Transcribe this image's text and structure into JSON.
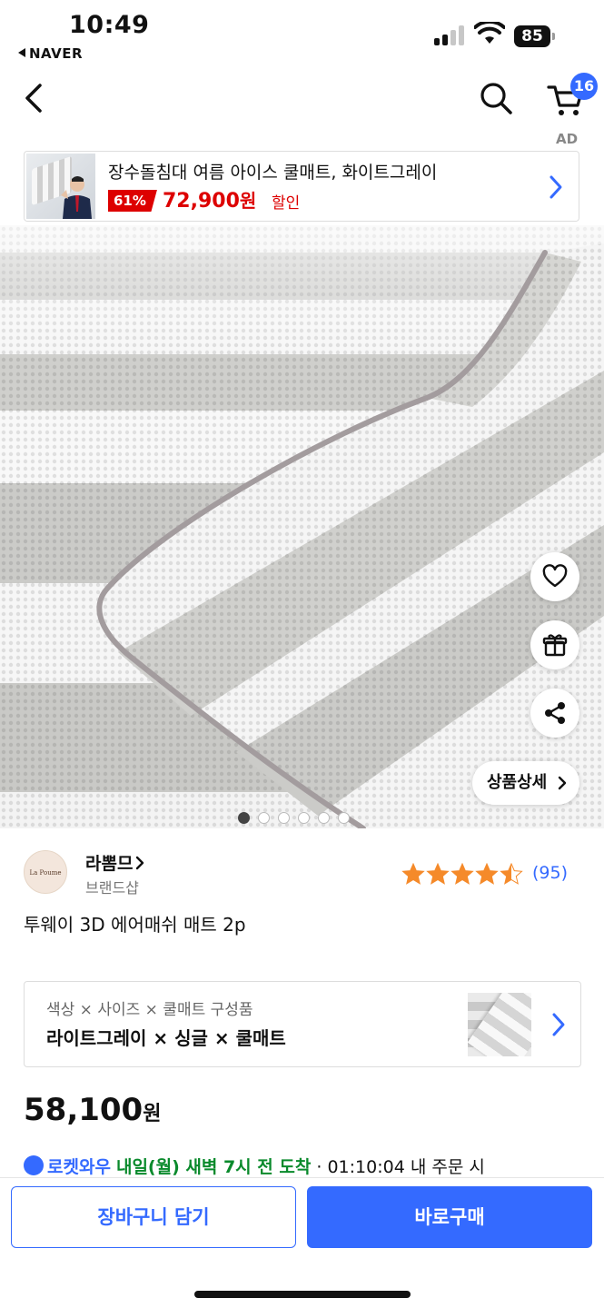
{
  "status_bar": {
    "time": "10:49",
    "back_app": "NAVER",
    "battery": "85"
  },
  "nav": {
    "cart_count": "16",
    "ad_label": "AD"
  },
  "ad_banner": {
    "title": "장수돌침대 여름 아이스 쿨매트, 화이트그레이",
    "discount": "61%",
    "price": "72,900",
    "price_unit": "원",
    "sale_label": "할인"
  },
  "hero": {
    "detail_button": "상품상세",
    "image_count": 6,
    "active_index": 0
  },
  "product": {
    "brand_logo_text": "La Poume",
    "brand_name": "라뽐므",
    "brand_sub": "브랜드샵",
    "rating": 4.5,
    "review_count": "(95)",
    "title": "투웨이 3D 에어매쉬 매트 2p"
  },
  "options": {
    "label": "색상 × 사이즈 × 쿨매트 구성품",
    "value": "라이트그레이 × 싱글 × 쿨매트"
  },
  "price": {
    "amount": "58,100",
    "unit": "원"
  },
  "delivery": {
    "badge": "로켓와우",
    "eta": "내일(월) 새벽 7시 전 도착",
    "countdown": "· 01:10:04",
    "suffix": "내 주문 시"
  },
  "bottom": {
    "cart_button": "장바구니 담기",
    "buy_button": "바로구매"
  },
  "colors": {
    "accent": "#346aff",
    "sale": "#dd0000",
    "delivery_green": "#0a8a2c"
  }
}
